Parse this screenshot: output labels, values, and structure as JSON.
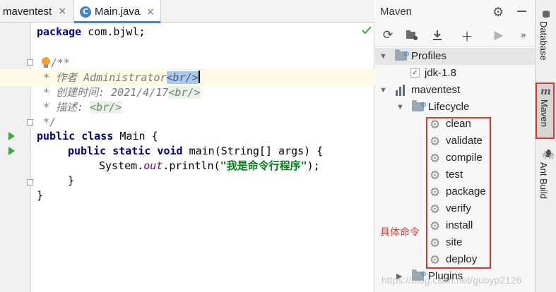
{
  "tabs": [
    {
      "label": "maventest",
      "close": "×"
    },
    {
      "label": "Main.java",
      "close": "×",
      "icon": "C"
    }
  ],
  "code": {
    "line1_kw": "package",
    "line1_rest": " com.bjwl;",
    "line3": "/**",
    "line4_comment": " * 作者 Administrator",
    "line4_tag": "<br/>",
    "line5_comment": " * 创建时间: 2021/4/17",
    "line5_tag": "<br/>",
    "line6_comment": " * 描述: ",
    "line6_tag": "<br/>",
    "line7": " */",
    "line8_kw": "public class",
    "line8_rest": " Main {",
    "line9_kw": "public static void",
    "line9_rest": " main(String[] args) {",
    "line10_a": "System.",
    "line10_field": "out",
    "line10_b": ".println(",
    "line10_str": "\"我是命令行程序\"",
    "line10_c": ");",
    "line11": "}",
    "line12": "}"
  },
  "maven": {
    "title": "Maven",
    "profiles_label": "Profiles",
    "profile_item": "jdk-1.8",
    "project": "maventest",
    "lifecycle": "Lifecycle",
    "goals": [
      "clean",
      "validate",
      "compile",
      "test",
      "package",
      "verify",
      "install",
      "site",
      "deploy"
    ],
    "plugins": "Plugins"
  },
  "annotation": "具体命令",
  "watermark": "https://blog.csdn.net/guoyp2126",
  "sidebar": {
    "database": "Database",
    "maven": "Maven",
    "ant": "Ant Build"
  }
}
